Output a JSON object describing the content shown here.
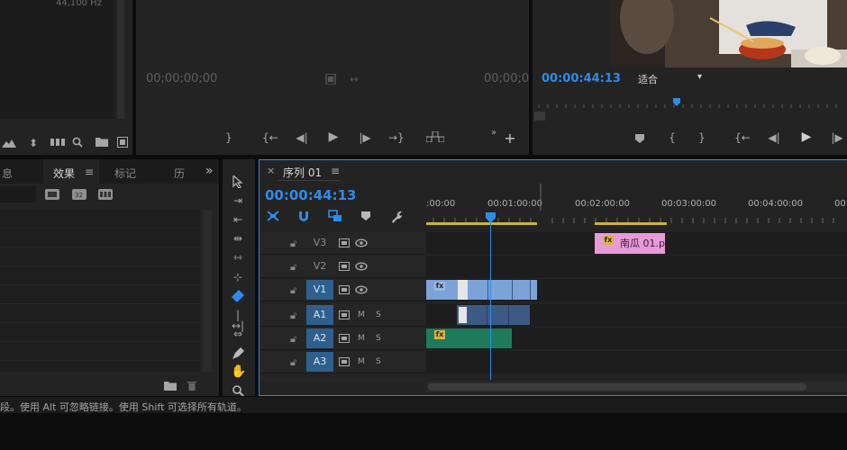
{
  "project_panel": {
    "audio_rate": "44,100 Hz"
  },
  "source_monitor": {
    "timecode_left": "00;00;00;00",
    "timecode_right": "00;00;0"
  },
  "program_monitor": {
    "timecode": "00:00:44:13",
    "fit_label": "适合",
    "fit_arrow": "▾"
  },
  "effects_panel": {
    "tab_info": "息",
    "tab_effects": "效果",
    "tab_menu": "≡",
    "tab_markers": "标记",
    "tab_history": "历",
    "tab_more": "»"
  },
  "timeline": {
    "close_glyph": "×",
    "tab_label": "序列 01",
    "tab_menu": "≡",
    "timecode": "00:00:44:13",
    "ruler": [
      ":00:00",
      "00:01:00:00",
      "00:02:00:00",
      "00:03:00:00",
      "00:04:00:00",
      "00:0"
    ],
    "tracks": [
      {
        "name": "V3",
        "mid": "",
        "right": ""
      },
      {
        "name": "V2",
        "mid": "",
        "right": ""
      },
      {
        "name": "V1",
        "mid": "",
        "right": ""
      },
      {
        "name": "A1",
        "mid": "M",
        "right": "S"
      },
      {
        "name": "A2",
        "mid": "M",
        "right": "S"
      },
      {
        "name": "A3",
        "mid": "M",
        "right": "S"
      }
    ],
    "clip_name": "南瓜 01.p",
    "fx_label": "fx"
  },
  "status_bar": {
    "text": "段。使用 Alt 可忽略链接。使用 Shift 可选择所有轨道。"
  },
  "colors": {
    "accent_blue": "#2d8ceb",
    "video_clip": "#7ba3d8",
    "audio_clip_a1": "#3d5a86",
    "audio_clip_a2": "#1f7a5c",
    "title_clip": "#e89ad8",
    "work_area": "#c9b33a"
  }
}
